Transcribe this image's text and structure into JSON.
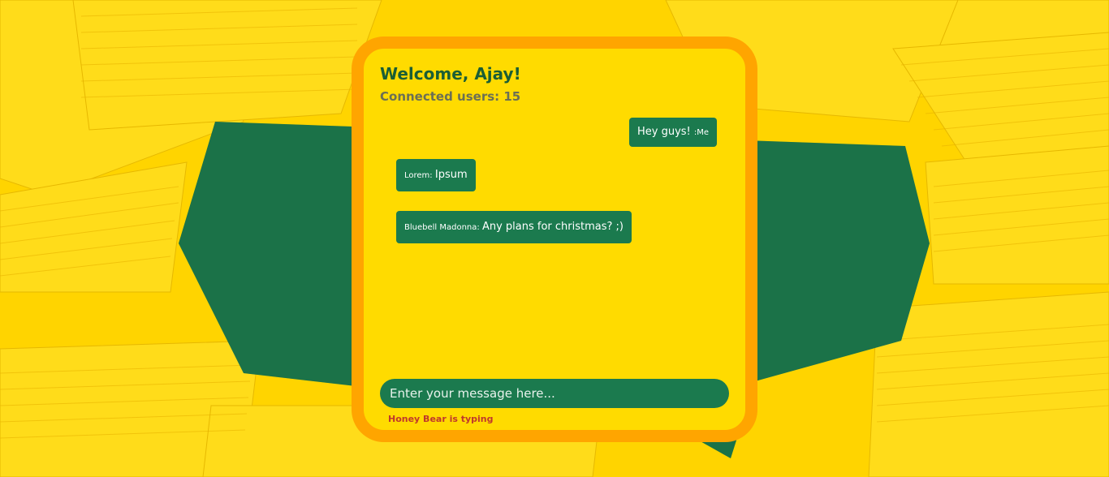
{
  "header": {
    "welcome": "Welcome, Ajay!",
    "connected": "Connected users: 15"
  },
  "messages": [
    {
      "sender": ":Me",
      "text": "Hey guys! ",
      "own": true
    },
    {
      "sender": "Lorem: ",
      "text": "Ipsum",
      "own": false
    },
    {
      "sender": "Bluebell Madonna: ",
      "text": "Any plans for christmas? ;)",
      "own": false
    }
  ],
  "composer": {
    "placeholder": "Enter your message here..."
  },
  "status": {
    "typing": "Honey Bear is typing"
  },
  "colors": {
    "background_yellow": "#ffd400",
    "card": "#ffdb00",
    "card_border": "#ffa500",
    "bubble": "#1b7a4e",
    "green_shape": "#1e7a4e",
    "typing": "#c0392b"
  }
}
